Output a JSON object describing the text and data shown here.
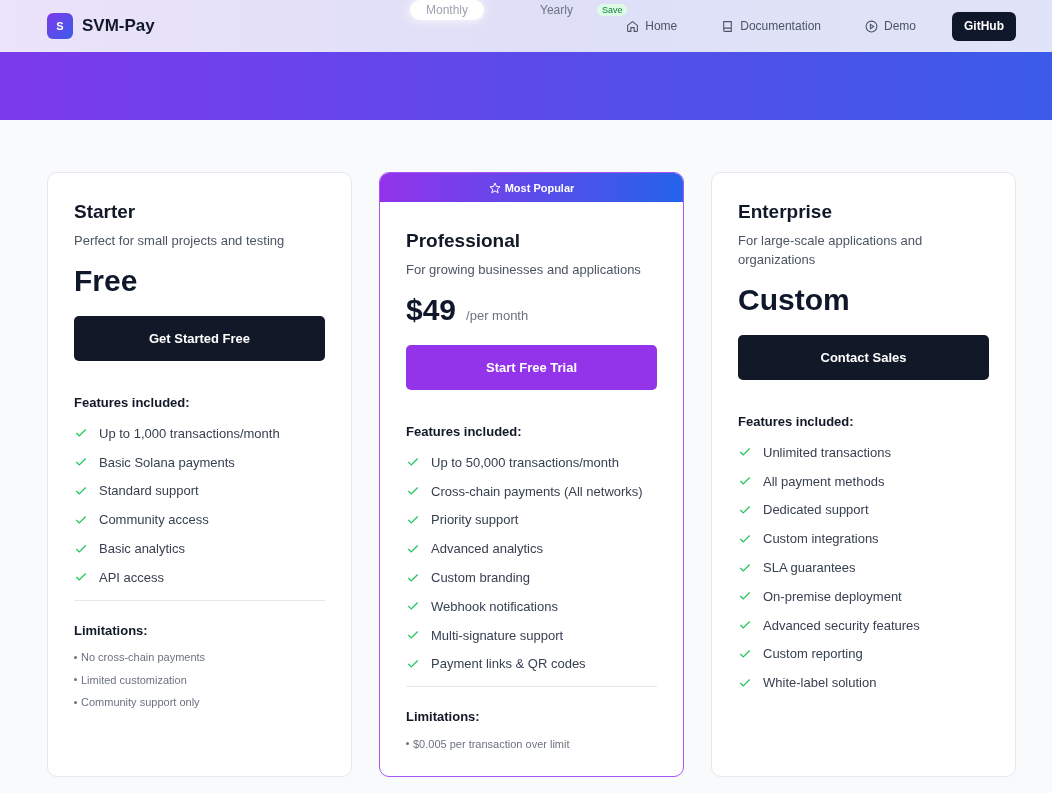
{
  "header": {
    "logo_letter": "S",
    "brand": "SVM-Pay",
    "nav": [
      {
        "label": "Home"
      },
      {
        "label": "Documentation"
      },
      {
        "label": "Demo"
      }
    ],
    "github": "GitHub"
  },
  "billing_toggle": {
    "options": [
      {
        "label": "Monthly",
        "selected": true
      },
      {
        "label": "Yearly",
        "selected": false
      }
    ],
    "badge": "Save"
  },
  "plans": [
    {
      "name": "Starter",
      "description": "Perfect for small projects and testing",
      "price": "Free",
      "featured": false,
      "cta": "Get Started Free",
      "features_title": "Features included:",
      "features": [
        "Up to 1,000 transactions/month",
        "Basic Solana payments",
        "Standard support",
        "Community access",
        "Basic analytics",
        "API access"
      ],
      "limitations_title": "Limitations:",
      "limitations": [
        "No cross-chain payments",
        "Limited customization",
        "Community support only"
      ]
    },
    {
      "name": "Professional",
      "badge": "Most Popular",
      "description": "For growing businesses and applications",
      "price": "$49",
      "period": "/per month",
      "featured": true,
      "cta": "Start Free Trial",
      "features_title": "Features included:",
      "features": [
        "Up to 50,000 transactions/month",
        "Cross-chain payments (All networks)",
        "Priority support",
        "Advanced analytics",
        "Custom branding",
        "Webhook notifications",
        "Multi-signature support",
        "Payment links & QR codes"
      ],
      "limitations_title": "Limitations:",
      "limitations": [
        "$0.005 per transaction over limit"
      ]
    },
    {
      "name": "Enterprise",
      "description": "For large-scale applications and organizations",
      "price": "Custom",
      "featured": false,
      "cta": "Contact Sales",
      "features_title": "Features included:",
      "features": [
        "Unlimited transactions",
        "All payment methods",
        "Dedicated support",
        "Custom integrations",
        "SLA guarantees",
        "On-premise deployment",
        "Advanced security features",
        "Custom reporting",
        "White-label solution"
      ]
    }
  ]
}
